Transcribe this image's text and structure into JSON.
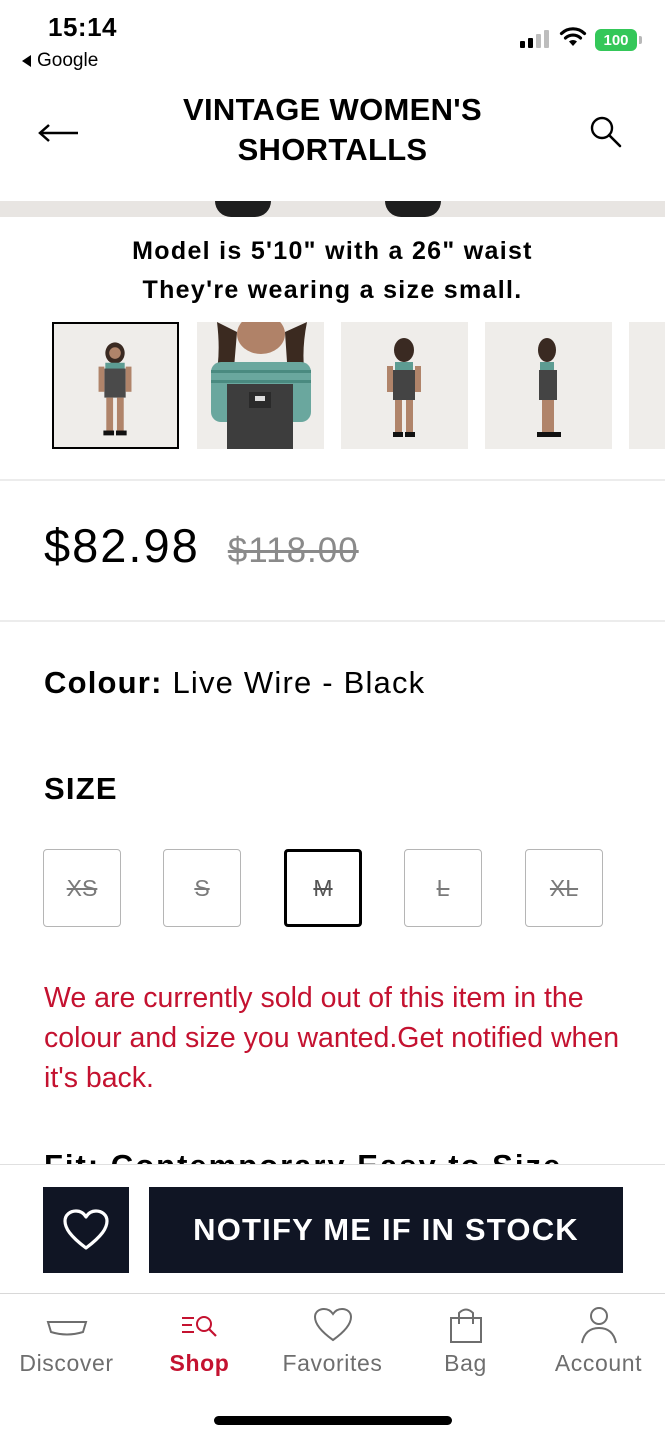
{
  "status_bar": {
    "time": "15:14",
    "back_app": "Google",
    "battery": "100"
  },
  "header": {
    "title": "VINTAGE WOMEN'S SHORTALLS",
    "back_icon": "arrow-left-icon",
    "search_icon": "search-icon"
  },
  "model_note": {
    "line1": "Model is 5'10\" with a 26\" waist",
    "line2": "They're wearing a size small."
  },
  "product": {
    "price": "$82.98",
    "original_price": "$118.00",
    "colour_label": "Colour:",
    "colour_value": "Live Wire - Black",
    "size_label": "SIZE",
    "sizes": [
      {
        "label": "XS",
        "available": false,
        "selected": false
      },
      {
        "label": "S",
        "available": false,
        "selected": false
      },
      {
        "label": "M",
        "available": false,
        "selected": true
      },
      {
        "label": "L",
        "available": false,
        "selected": false
      },
      {
        "label": "XL",
        "available": false,
        "selected": false
      }
    ],
    "soldout_message": "We are currently sold out of this item in the colour and size you wanted.Get notified when it's back.",
    "fit_peek": "Fit: Contemporary Easy to Size"
  },
  "actions": {
    "wishlist_icon": "heart-icon",
    "notify_label": "NOTIFY ME IF IN STOCK"
  },
  "tabs": [
    {
      "label": "Discover",
      "icon": "discover-icon",
      "active": false
    },
    {
      "label": "Shop",
      "icon": "shop-search-icon",
      "active": true
    },
    {
      "label": "Favorites",
      "icon": "heart-icon",
      "active": false
    },
    {
      "label": "Bag",
      "icon": "bag-icon",
      "active": false
    },
    {
      "label": "Account",
      "icon": "account-icon",
      "active": false
    }
  ],
  "colors": {
    "accent_red": "#c41230",
    "button_dark": "#101524",
    "battery_green": "#34c759"
  }
}
